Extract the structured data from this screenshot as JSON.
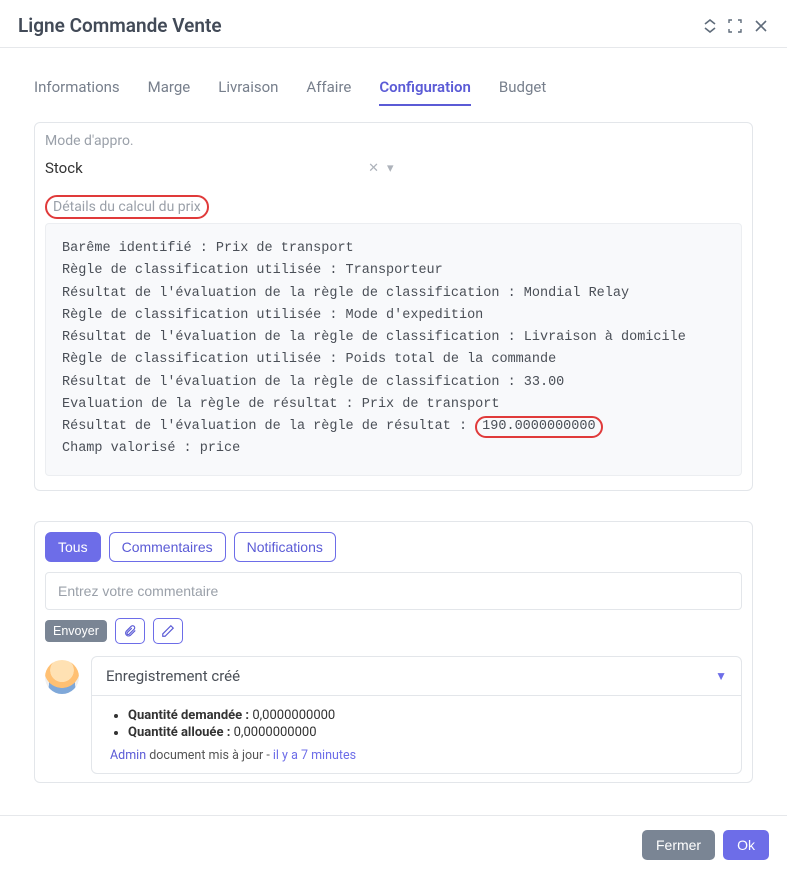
{
  "dialog": {
    "title": "Ligne Commande Vente"
  },
  "tabs": [
    {
      "label": "Informations",
      "active": false
    },
    {
      "label": "Marge",
      "active": false
    },
    {
      "label": "Livraison",
      "active": false
    },
    {
      "label": "Affaire",
      "active": false
    },
    {
      "label": "Configuration",
      "active": true
    },
    {
      "label": "Budget",
      "active": false
    }
  ],
  "config": {
    "mode_label": "Mode d'appro.",
    "mode_value": "Stock",
    "details_label": "Détails du calcul du prix",
    "log_lines": [
      "Barême identifié : Prix de transport",
      "Règle de classification utilisée : Transporteur",
      "Résultat de l'évaluation de la règle de classification : Mondial Relay",
      "Règle de classification utilisée : Mode d'expedition",
      "Résultat de l'évaluation de la règle de classification : Livraison à domicile",
      "Règle de classification utilisée : Poids total de la commande",
      "Résultat de l'évaluation de la règle de classification : 33.00",
      "Evaluation de la règle de résultat : Prix de transport"
    ],
    "result_prefix": "Résultat de l'évaluation de la règle de résultat : ",
    "result_value": "190.0000000000",
    "last_line": "Champ valorisé : price"
  },
  "comments": {
    "pills": {
      "all": "Tous",
      "comments": "Commentaires",
      "notifications": "Notifications"
    },
    "placeholder": "Entrez votre commentaire",
    "send_label": "Envoyer",
    "entry": {
      "title": "Enregistrement créé",
      "items": [
        {
          "label": "Quantité demandée :",
          "value": "0,0000000000"
        },
        {
          "label": "Quantité allouée :",
          "value": "0,0000000000"
        }
      ],
      "user": "Admin",
      "action": "document mis à jour",
      "sep": " - ",
      "time": "il y a 7 minutes"
    }
  },
  "footer": {
    "close": "Fermer",
    "ok": "Ok"
  }
}
